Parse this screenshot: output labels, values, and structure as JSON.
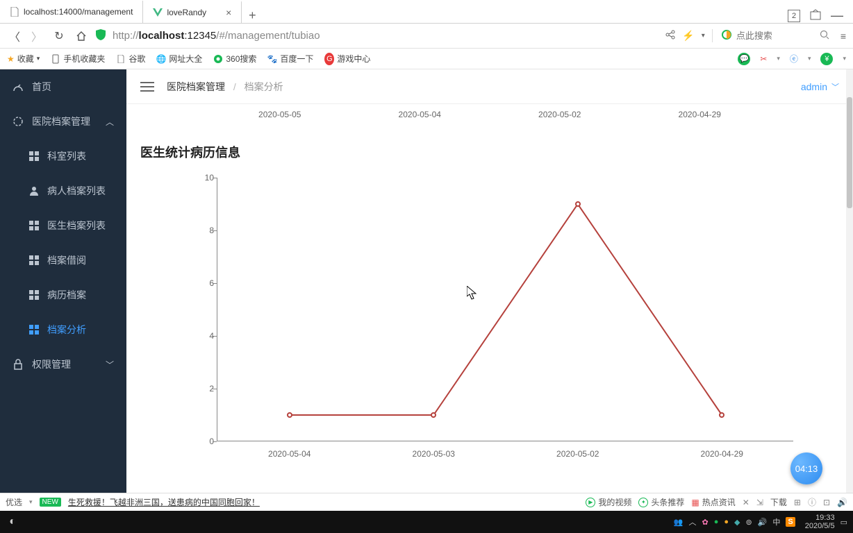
{
  "tabs": {
    "t0": "localhost:14000/management",
    "t1": "loveRandy",
    "count": "2"
  },
  "url": {
    "pre": "http://",
    "host": "localhost",
    "port": ":12345",
    "path": "/#/management/tubiao"
  },
  "search": {
    "placeholder": "点此搜索"
  },
  "bookmarks": {
    "b0": "收藏",
    "b1": "手机收藏夹",
    "b2": "谷歌",
    "b3": "网址大全",
    "b4": "360搜索",
    "b5": "百度一下",
    "b6": "游戏中心"
  },
  "sidebar": {
    "home": "首页",
    "group1": "医院档案管理",
    "i0": "科室列表",
    "i1": "病人档案列表",
    "i2": "医生档案列表",
    "i3": "档案借阅",
    "i4": "病历档案",
    "i5": "档案分析",
    "group2": "权限管理"
  },
  "crumb": {
    "root": "医院档案管理",
    "cur": "档案分析"
  },
  "user": "admin",
  "row_dates": {
    "d0": "2020-05-05",
    "d1": "2020-05-04",
    "d2": "2020-05-02",
    "d3": "2020-04-29"
  },
  "chart_title": "医生统计病历信息",
  "chart_data": {
    "type": "line",
    "categories": [
      "2020-05-04",
      "2020-05-03",
      "2020-05-02",
      "2020-04-29"
    ],
    "values": [
      1,
      1,
      9,
      1
    ],
    "ylim": [
      0,
      10
    ],
    "yticks": [
      0,
      2,
      4,
      6,
      8,
      10
    ],
    "line_color": "#b5413c"
  },
  "status": {
    "tag": "优选",
    "new": "NEW",
    "headline": "生死救援！飞越非洲三国，送患病的中国同胞回家！",
    "s0": "我的视频",
    "s1": "头条推荐",
    "s2": "热点资讯",
    "s3": "下载"
  },
  "fab": "04:13",
  "tray": {
    "ime": "中",
    "time": "19:33",
    "date": "2020/5/5"
  }
}
